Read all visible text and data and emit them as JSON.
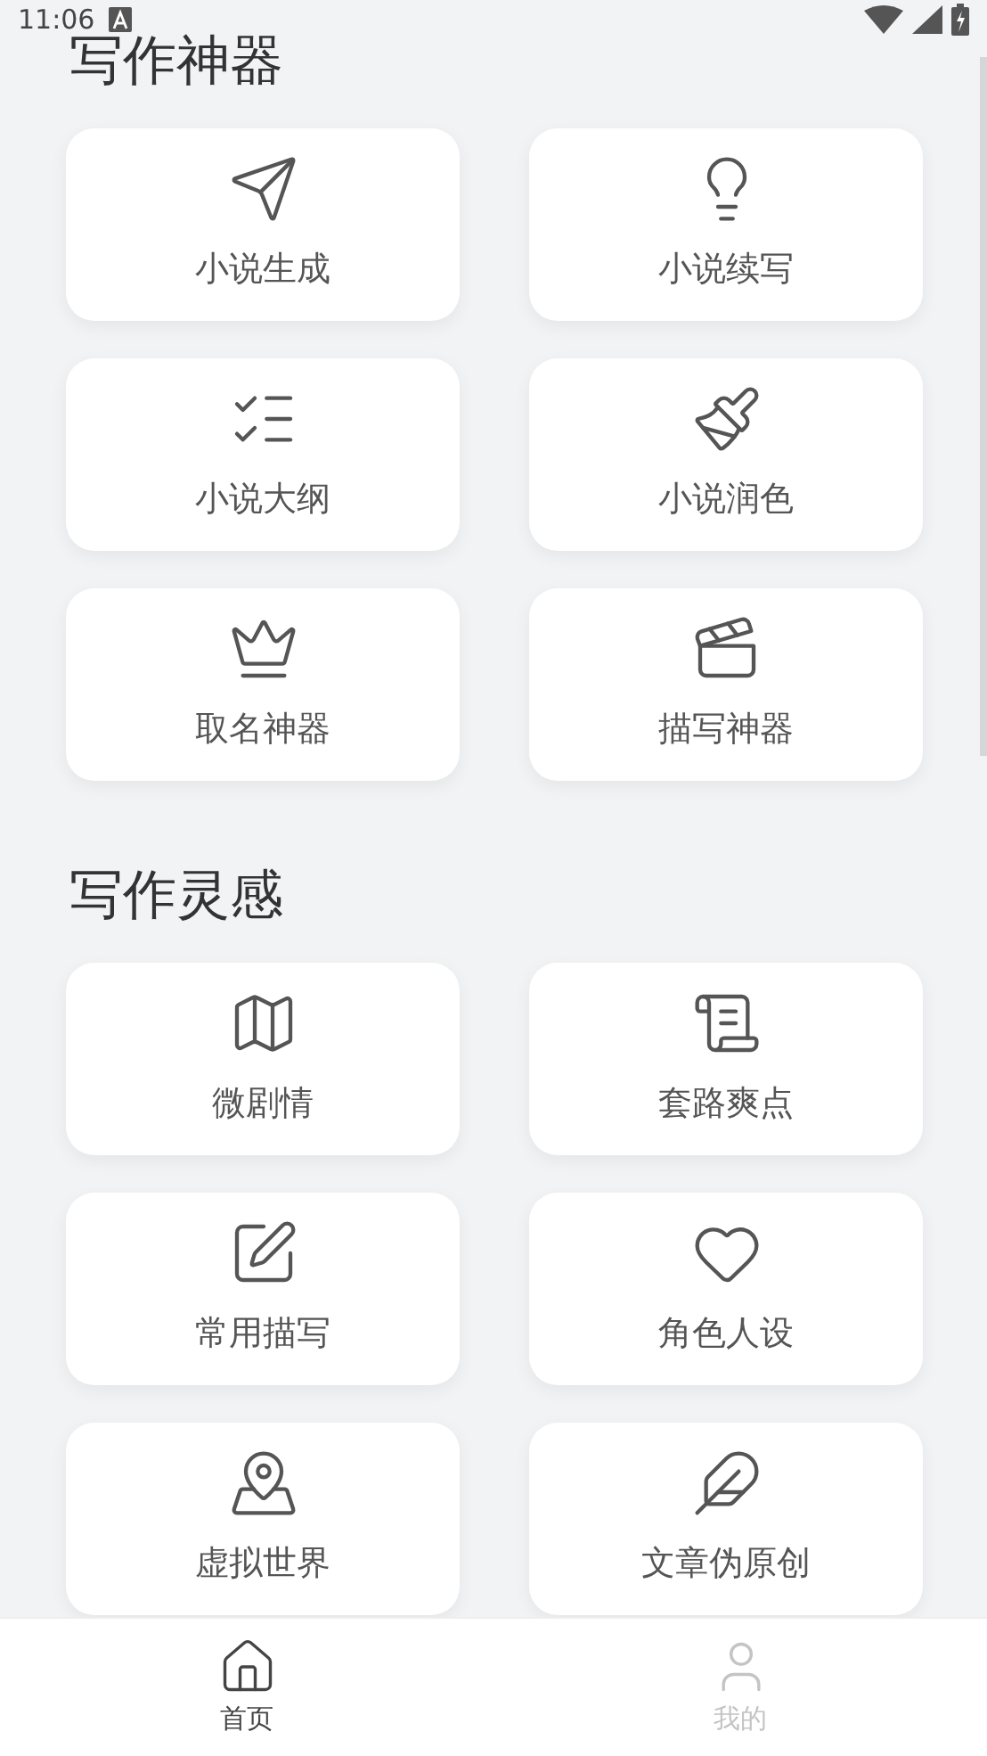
{
  "status_bar": {
    "time": "11:06"
  },
  "sections": [
    {
      "title": "写作神器",
      "items": [
        {
          "label": "小说生成"
        },
        {
          "label": "小说续写"
        },
        {
          "label": "小说大纲"
        },
        {
          "label": "小说润色"
        },
        {
          "label": "取名神器"
        },
        {
          "label": "描写神器"
        }
      ]
    },
    {
      "title": "写作灵感",
      "items": [
        {
          "label": "微剧情"
        },
        {
          "label": "套路爽点"
        },
        {
          "label": "常用描写"
        },
        {
          "label": "角色人设"
        },
        {
          "label": "虚拟世界"
        },
        {
          "label": "文章伪原创"
        }
      ]
    }
  ],
  "bottom_nav": [
    {
      "label": "首页",
      "selected": true
    },
    {
      "label": "我的",
      "selected": false
    }
  ]
}
